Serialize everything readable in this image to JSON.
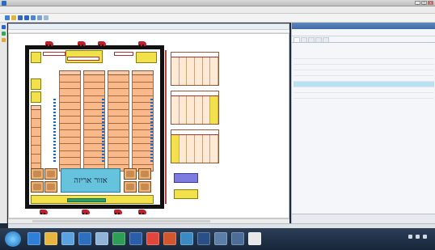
{
  "window": {
    "title": ""
  },
  "menu": {
    "items": [
      "",
      "",
      "",
      "",
      "",
      "",
      "",
      "",
      "",
      "",
      "",
      "",
      "",
      ""
    ]
  },
  "document": {
    "tab_label": "",
    "zoom_text": ""
  },
  "floorplan": {
    "packing_area_label": "אזור אריזה",
    "top_labels": [
      "",
      "",
      ""
    ],
    "rack_headers": [
      "",
      "",
      "",
      ""
    ],
    "rows_per_rack": 14,
    "side_rack_headers": [
      "",
      "",
      ""
    ],
    "side_small_labels": [
      "",
      ""
    ],
    "colors": {
      "rack_fill": "#f9b98a",
      "yellow": "#f2e14a",
      "packing": "#65c3dd",
      "truck": "#c21f2a",
      "green": "#29a06a",
      "purple": "#7c7ce0"
    }
  },
  "properties": {
    "title": "",
    "toolbar": [
      "",
      ""
    ],
    "tabs": [
      "",
      "",
      "",
      "",
      ""
    ],
    "rows": [
      {
        "k": "",
        "v": ""
      },
      {
        "k": "",
        "v": ""
      },
      {
        "k": "",
        "v": ""
      },
      {
        "k": "",
        "v": ""
      },
      {
        "k": "",
        "v": ""
      },
      {
        "k": "",
        "v": ""
      },
      {
        "k": "",
        "v": ""
      },
      {
        "k": "",
        "v": ""
      }
    ],
    "selected_row": 5,
    "footer": [
      "",
      ""
    ]
  },
  "statusbar": {
    "left": "",
    "right": ""
  },
  "taskbar": {
    "apps": [
      "ie-icon",
      "folder-icon",
      "media-icon",
      "outlook-icon",
      "search-icon",
      "excel-icon",
      "word-icon",
      "chrome-icon",
      "powerpoint-icon",
      "photos-icon",
      "app-icon",
      "app-icon",
      "app-icon",
      "app-icon"
    ],
    "clock": ""
  }
}
